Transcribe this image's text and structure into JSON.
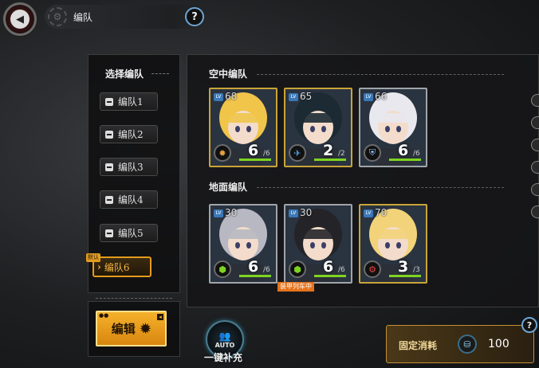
{
  "header": {
    "title": "编队",
    "back_icon": "back-arrow-icon",
    "help_label": "?"
  },
  "squads": {
    "heading": "选择编队",
    "items": [
      {
        "label": "编队1"
      },
      {
        "label": "编队2"
      },
      {
        "label": "编队3"
      },
      {
        "label": "编队4"
      },
      {
        "label": "编队5"
      }
    ],
    "active": {
      "label": "编队6",
      "tag": "默认"
    },
    "edit_label": "编辑"
  },
  "air": {
    "title": "空中编队",
    "cards": [
      {
        "level": "68",
        "count": "6",
        "max": "/6",
        "hp": 1.0,
        "frame": "#c9a438",
        "hair": "#f0c54a",
        "type_icon": "flame-icon",
        "type_color": "#e8a33a"
      },
      {
        "level": "65",
        "count": "2",
        "max": "/2",
        "hp": 1.0,
        "frame": "#c9a438",
        "hair": "#1c2a33",
        "type_icon": "wing-icon",
        "type_color": "#5aa6e6"
      },
      {
        "level": "66",
        "count": "6",
        "max": "/6",
        "hp": 1.0,
        "frame": "#a0a5aa",
        "hair": "#e8e8ee",
        "type_icon": "shield-icon",
        "type_color": "#9cc5ff"
      }
    ]
  },
  "ground": {
    "title": "地面编队",
    "cards": [
      {
        "level": "30",
        "count": "6",
        "max": "/6",
        "hp": 1.0,
        "frame": "#a0a5aa",
        "hair": "#b8b8c2",
        "type_icon": "hex-icon",
        "type_color": "#7ed321"
      },
      {
        "level": "30",
        "count": "6",
        "max": "/6",
        "hp": 1.0,
        "frame": "#a0a5aa",
        "hair": "#242428",
        "type_icon": "hex-icon",
        "type_color": "#7ed321"
      },
      {
        "level": "70",
        "count": "3",
        "max": "/3",
        "hp": 1.0,
        "frame": "#c9a438",
        "hair": "#f2d37a",
        "type_icon": "gear-icon",
        "type_color": "#e84444"
      }
    ],
    "note": "装甲列车中"
  },
  "bottom": {
    "auto_text": "AUTO",
    "auto_label": "一键补充",
    "cost_label": "固定消耗",
    "cost_value": "100",
    "help_label": "?"
  }
}
